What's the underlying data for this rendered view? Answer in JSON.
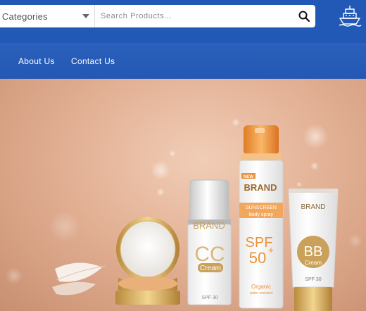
{
  "header": {
    "category_label": "l Categories",
    "search_placeholder": "Search Products...",
    "search_icon": "search-icon",
    "cart_icon": "ship-icon"
  },
  "nav": {
    "items": [
      "About Us",
      "Contact Us"
    ]
  },
  "hero": {
    "products": {
      "spray": {
        "badge": "NEW",
        "brand": "BRAND",
        "line1": "SUNSCREEN",
        "line2": "body spray",
        "spf": "SPF",
        "spf_value": "50",
        "plus": "+",
        "footer1": "Organic",
        "footer2": "water resistant"
      },
      "cc_bottle": {
        "brand": "BRAND",
        "mark": "CC",
        "sub": "Cream",
        "spf": "SPF 30"
      },
      "bb_tube": {
        "brand": "BRAND",
        "mark": "BB",
        "sub": "Cream",
        "spf": "SPF 30"
      }
    }
  },
  "colors": {
    "header_blue": "#2258b6",
    "nav_blue": "#2358b4",
    "accent_orange": "#e8923a",
    "gold": "#c9a15a"
  }
}
